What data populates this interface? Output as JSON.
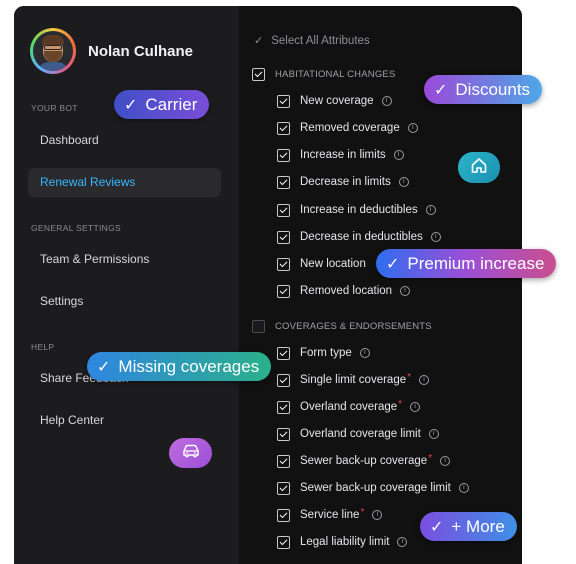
{
  "profile": {
    "name": "Nolan Culhane"
  },
  "sidebar": {
    "sections": [
      {
        "label": "YOUR BOT"
      },
      {
        "label": "GENERAL SETTINGS"
      },
      {
        "label": "HELP"
      }
    ],
    "items": [
      {
        "label": "Dashboard"
      },
      {
        "label": "Renewal Reviews",
        "active": true
      },
      {
        "label": "Team & Permissions"
      },
      {
        "label": "Settings"
      },
      {
        "label": "Share Feedback"
      },
      {
        "label": "Help Center"
      }
    ]
  },
  "main": {
    "select_all": "Select All Attributes",
    "groups": [
      {
        "label": "HABITATIONAL CHANGES",
        "checked": true,
        "items": [
          {
            "label": "New coverage",
            "checked": true
          },
          {
            "label": "Removed coverage",
            "checked": true
          },
          {
            "label": "Increase in limits",
            "checked": true
          },
          {
            "label": "Decrease in limits",
            "checked": true
          },
          {
            "label": "Increase in deductibles",
            "checked": true
          },
          {
            "label": "Decrease in deductibles",
            "checked": true
          },
          {
            "label": "New location",
            "checked": true
          },
          {
            "label": "Removed location",
            "checked": true
          }
        ]
      },
      {
        "label": "COVERAGES & ENDORSEMENTS",
        "checked": false,
        "items": [
          {
            "label": "Form type",
            "checked": true,
            "required": false
          },
          {
            "label": "Single limit coverage",
            "checked": true,
            "required": true
          },
          {
            "label": "Overland coverage",
            "checked": true,
            "required": true
          },
          {
            "label": "Overland coverage limit",
            "checked": true,
            "required": false
          },
          {
            "label": "Sewer back-up coverage",
            "checked": true,
            "required": true
          },
          {
            "label": "Sewer back-up coverage limit",
            "checked": true,
            "required": false
          },
          {
            "label": "Service line",
            "checked": true,
            "required": true
          },
          {
            "label": "Legal liability limit",
            "checked": true,
            "required": false
          }
        ]
      }
    ]
  },
  "pills": {
    "carrier": "Carrier",
    "discounts": "Discounts",
    "premium_increase": "Premium increase",
    "missing_coverages": "Missing coverages",
    "more": "+ More"
  },
  "icons": {
    "check": "check-icon",
    "info": "info-icon",
    "home": "home-icon",
    "car": "car-icon"
  },
  "colors": {
    "accent_blue": "#38b6ff",
    "required_red": "#e5484d",
    "pill_carrier": "#4a5fd0",
    "pill_discounts": "#9b4fd6",
    "pill_premium": "#2f6df0",
    "pill_missing": "#2fa3d8",
    "pill_more": "#7a4fdf"
  }
}
